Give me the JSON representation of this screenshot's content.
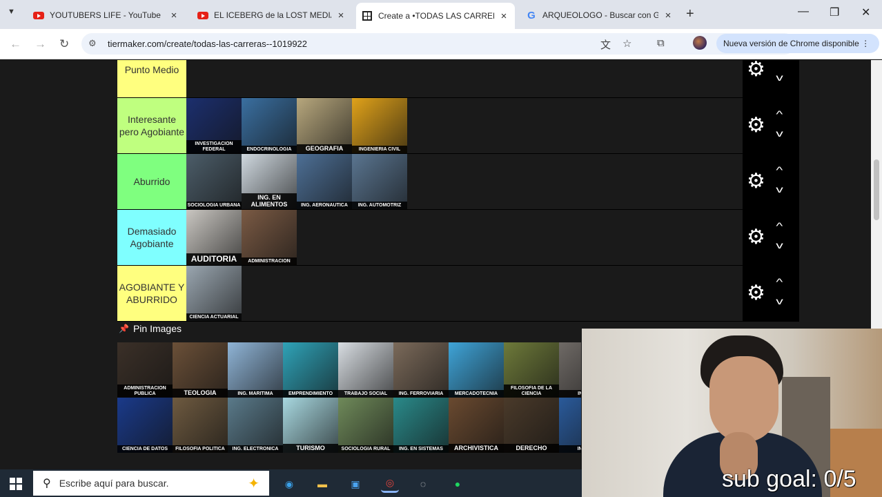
{
  "browser": {
    "tabs": [
      {
        "title": "YOUTUBERS LIFE - YouTube",
        "icon": "youtube-icon"
      },
      {
        "title": "EL ICEBERG de la LOST MEDIA",
        "icon": "youtube-icon"
      },
      {
        "title": "Create a •TODAS LAS CARRERAS",
        "icon": "tiermaker-icon"
      },
      {
        "title": "ARQUEOLOGO - Buscar con Go",
        "icon": "google-icon"
      }
    ],
    "url": "tiermaker.com/create/todas-las-carreras--1019922",
    "update_label": "Nueva versión de Chrome disponible",
    "new_tab_glyph": "+",
    "close_glyph": "×"
  },
  "tiers": [
    {
      "label": "Punto Medio",
      "color": "#ffff7f",
      "items": []
    },
    {
      "label": "Interesante pero Agobiante",
      "color": "#bfff7f",
      "items": [
        {
          "caption": "Investigacion federal",
          "bg": "#1c2f6e",
          "size": "sm"
        },
        {
          "caption": "Endocrinologia",
          "bg": "#3a6fa0",
          "size": "sm"
        },
        {
          "caption": "Geografia",
          "bg": "#b7a77d",
          "size": "mid"
        },
        {
          "caption": "Ingenieria civil",
          "bg": "#e0a21a",
          "size": "sm"
        }
      ]
    },
    {
      "label": "Aburrido",
      "color": "#7fff7f",
      "items": [
        {
          "caption": "Sociologia urbana",
          "bg": "#4c5d69",
          "size": "sm"
        },
        {
          "caption": "Ing. en alimentos",
          "bg": "#cfd8df",
          "size": "mid"
        },
        {
          "caption": "Ing. aeronautica",
          "bg": "#4d6f95",
          "size": "sm"
        },
        {
          "caption": "Ing. automotriz",
          "bg": "#5a7590",
          "size": "sm"
        }
      ]
    },
    {
      "label": "Demasiado Agobiante",
      "color": "#7fffff",
      "items": [
        {
          "caption": "Auditoria",
          "bg": "#c9c6c1",
          "size": "big"
        },
        {
          "caption": "Administracion",
          "bg": "#7a5a44",
          "size": "sm"
        }
      ]
    },
    {
      "label": "AGOBIANTE Y ABURRIDO",
      "color": "#ffff7f",
      "items": [
        {
          "caption": "Ciencia actuarial",
          "bg": "#9aa6b0",
          "size": "sm"
        }
      ]
    }
  ],
  "pool": {
    "title": "Pin Images",
    "rows": [
      [
        {
          "caption": "Administracion publica",
          "bg": "#3b3028",
          "size": "sm"
        },
        {
          "caption": "Teologia",
          "bg": "#6b5038",
          "size": "mid"
        },
        {
          "caption": "Ing. maritima",
          "bg": "#8fb4d6",
          "size": "sm"
        },
        {
          "caption": "Emprendimiento",
          "bg": "#2fa3b8",
          "size": "sm"
        },
        {
          "caption": "Trabajo social",
          "bg": "#d8dde2",
          "size": "sm"
        },
        {
          "caption": "Ing. ferroviaria",
          "bg": "#7b6a5a",
          "size": "sm"
        },
        {
          "caption": "Mercadotecnia",
          "bg": "#3fa4d8",
          "size": "sm"
        },
        {
          "caption": "Filosofia de la ciencia",
          "bg": "#6e7a3a",
          "size": "sm"
        },
        {
          "caption": "Ing. pe",
          "bg": "#6f6a66",
          "size": "sm"
        }
      ],
      [
        {
          "caption": "Ciencia de datos",
          "bg": "#1a3a8a",
          "size": "sm"
        },
        {
          "caption": "Filosofia politica",
          "bg": "#6e5a40",
          "size": "sm"
        },
        {
          "caption": "Ing. electronica",
          "bg": "#5a7a8a",
          "size": "sm"
        },
        {
          "caption": "Turismo",
          "bg": "#a8d8e0",
          "size": "mid"
        },
        {
          "caption": "Sociologia rural",
          "bg": "#6f8a5a",
          "size": "sm"
        },
        {
          "caption": "Ing. en sistemas",
          "bg": "#2a8a8a",
          "size": "sm"
        },
        {
          "caption": "Archivistica",
          "bg": "#6a4a30",
          "size": "mid"
        },
        {
          "caption": "Derecho",
          "bg": "#4a3a2a",
          "size": "mid"
        },
        {
          "caption": "Ing. co",
          "bg": "#2a5a9a",
          "size": "sm"
        }
      ]
    ]
  },
  "overlay": {
    "sub_goal": "sub goal: 0/5"
  },
  "taskbar": {
    "search_placeholder": "Escribe aquí para buscar."
  }
}
